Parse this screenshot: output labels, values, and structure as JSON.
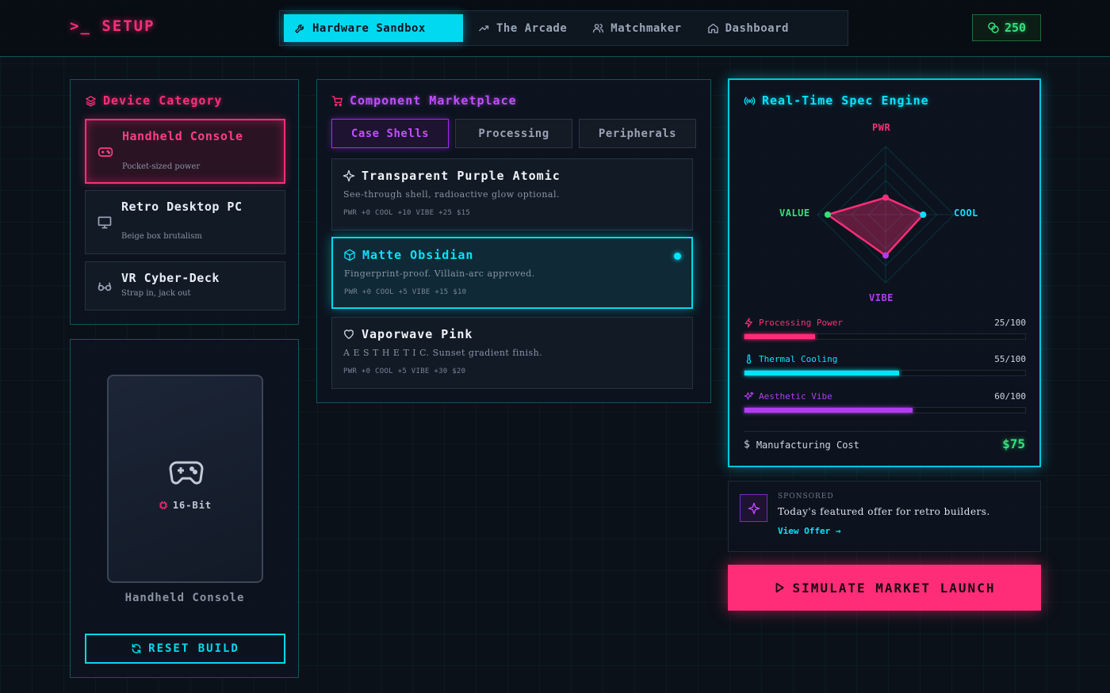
{
  "header": {
    "logo_prompt": ">_",
    "logo_text": "SETUP",
    "nav": [
      {
        "label": "Hardware Sandbox",
        "icon": "wrench-icon",
        "active": true
      },
      {
        "label": "The Arcade",
        "icon": "trend-icon"
      },
      {
        "label": "Matchmaker",
        "icon": "users-icon"
      },
      {
        "label": "Dashboard",
        "icon": "home-icon"
      }
    ],
    "credits": "250"
  },
  "device_category": {
    "title": "Device Category",
    "items": [
      {
        "name": "Handheld Console",
        "sub": "Pocket-sized power",
        "icon": "gamepad-icon",
        "active": true
      },
      {
        "name": "Retro Desktop PC",
        "sub": "Beige box brutalism",
        "icon": "monitor-icon"
      },
      {
        "name": "VR Cyber-Deck",
        "sub": "Strap in, jack out",
        "icon": "glasses-icon"
      }
    ]
  },
  "preview": {
    "chip_label": "16-Bit",
    "device_label": "Handheld Console",
    "reset_label": "RESET BUILD"
  },
  "marketplace": {
    "title": "Component Marketplace",
    "tabs": [
      "Case Shells",
      "Processing",
      "Peripherals"
    ],
    "active_tab": 0,
    "items": [
      {
        "name": "Transparent Purple Atomic",
        "desc": "See-through shell, radioactive glow optional.",
        "stats": "PWR +0  COOL +10  VIBE +25  $15",
        "icon": "sparkle-icon"
      },
      {
        "name": "Matte Obsidian",
        "desc": "Fingerprint-proof. Villain-arc approved.",
        "stats": "PWR +0  COOL +5  VIBE +15  $10",
        "icon": "cube-icon",
        "active": true
      },
      {
        "name": "Vaporwave Pink",
        "desc": "A E S T H E T I C. Sunset gradient finish.",
        "stats": "PWR +0  COOL +5  VIBE +30  $20",
        "icon": "heart-icon"
      }
    ]
  },
  "spec_engine": {
    "title": "Real-Time Spec Engine",
    "radar": {
      "axes": [
        "PWR",
        "COOL",
        "VIBE",
        "VALUE"
      ],
      "values": [
        25,
        55,
        60,
        85
      ],
      "max": 100
    },
    "bars": [
      {
        "label": "Processing Power",
        "value": 25,
        "max": 100,
        "display": "25/100",
        "color": "#ff2d78",
        "icon": "bolt-icon"
      },
      {
        "label": "Thermal Cooling",
        "value": 55,
        "max": 100,
        "display": "55/100",
        "color": "#00e5ff",
        "icon": "thermometer-icon"
      },
      {
        "label": "Aesthetic Vibe",
        "value": 60,
        "max": 100,
        "display": "60/100",
        "color": "#b23cf0",
        "icon": "sparkles-icon"
      }
    ],
    "cost_label": "Manufacturing Cost",
    "cost_value": "$75"
  },
  "sponsored": {
    "tag": "SPONSORED",
    "text": "Today's featured offer for retro builders.",
    "link": "View Offer →"
  },
  "launch_label": "SIMULATE MARKET LAUNCH",
  "colors": {
    "pink": "#ff2d78",
    "cyan": "#00e5ff",
    "purple": "#b23cf0",
    "green": "#35e07a"
  }
}
